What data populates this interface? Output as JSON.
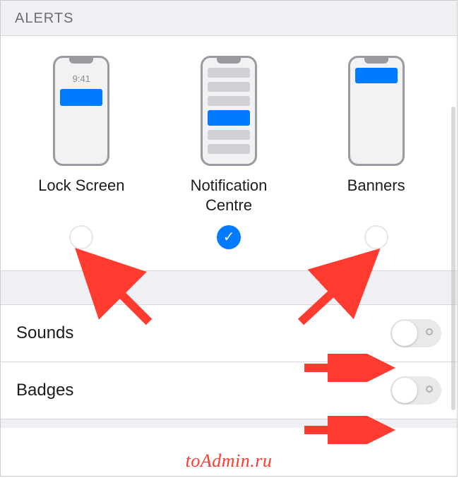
{
  "section_header": "ALERTS",
  "alerts": {
    "lock_screen": {
      "label": "Lock Screen",
      "time": "9:41",
      "checked": false
    },
    "notification_centre": {
      "label": "Notification Centre",
      "checked": true
    },
    "banners": {
      "label": "Banners",
      "checked": false
    }
  },
  "rows": {
    "sounds": {
      "label": "Sounds",
      "on": false
    },
    "badges": {
      "label": "Badges",
      "on": false
    }
  },
  "watermark": "toAdmin.ru"
}
